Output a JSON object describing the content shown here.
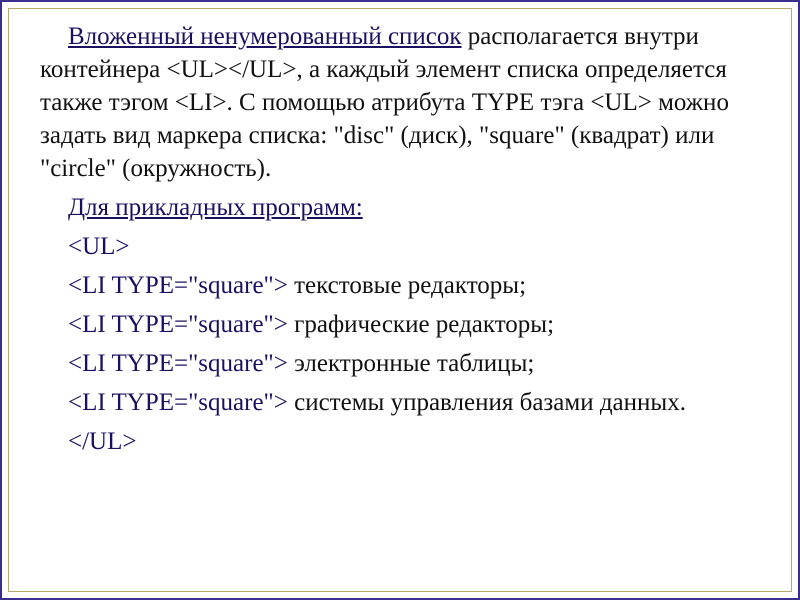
{
  "p1": {
    "title": "Вложенный ненумерованный список",
    "rest1": " располагается внутри контейнера <UL></UL>, а каждый элемент списка определяется также тэгом <LI>. С помощью атрибута TYPE тэга <UL> можно задать вид маркера списка: \"disc\" (диск), \"square\" (квадрат)  или \"circle\"   (окружность)."
  },
  "p2": "Для прикладных программ:",
  "p3": "<UL>",
  "p4": {
    "tag": "<LI  TYPE=\"square\">",
    "text": " текстовые редакторы;"
  },
  "p5": {
    "tag": "<LI  TYPE=\"square\">",
    "text": " графические редакторы;"
  },
  "p6": {
    "tag": "<LI  TYPE=\"square\">",
    "text": " электронные таблицы;"
  },
  "p7": {
    "tag": "<LI   TYPE=\"square\">",
    "text": " системы управления базами данных."
  },
  "p8": "</UL>"
}
